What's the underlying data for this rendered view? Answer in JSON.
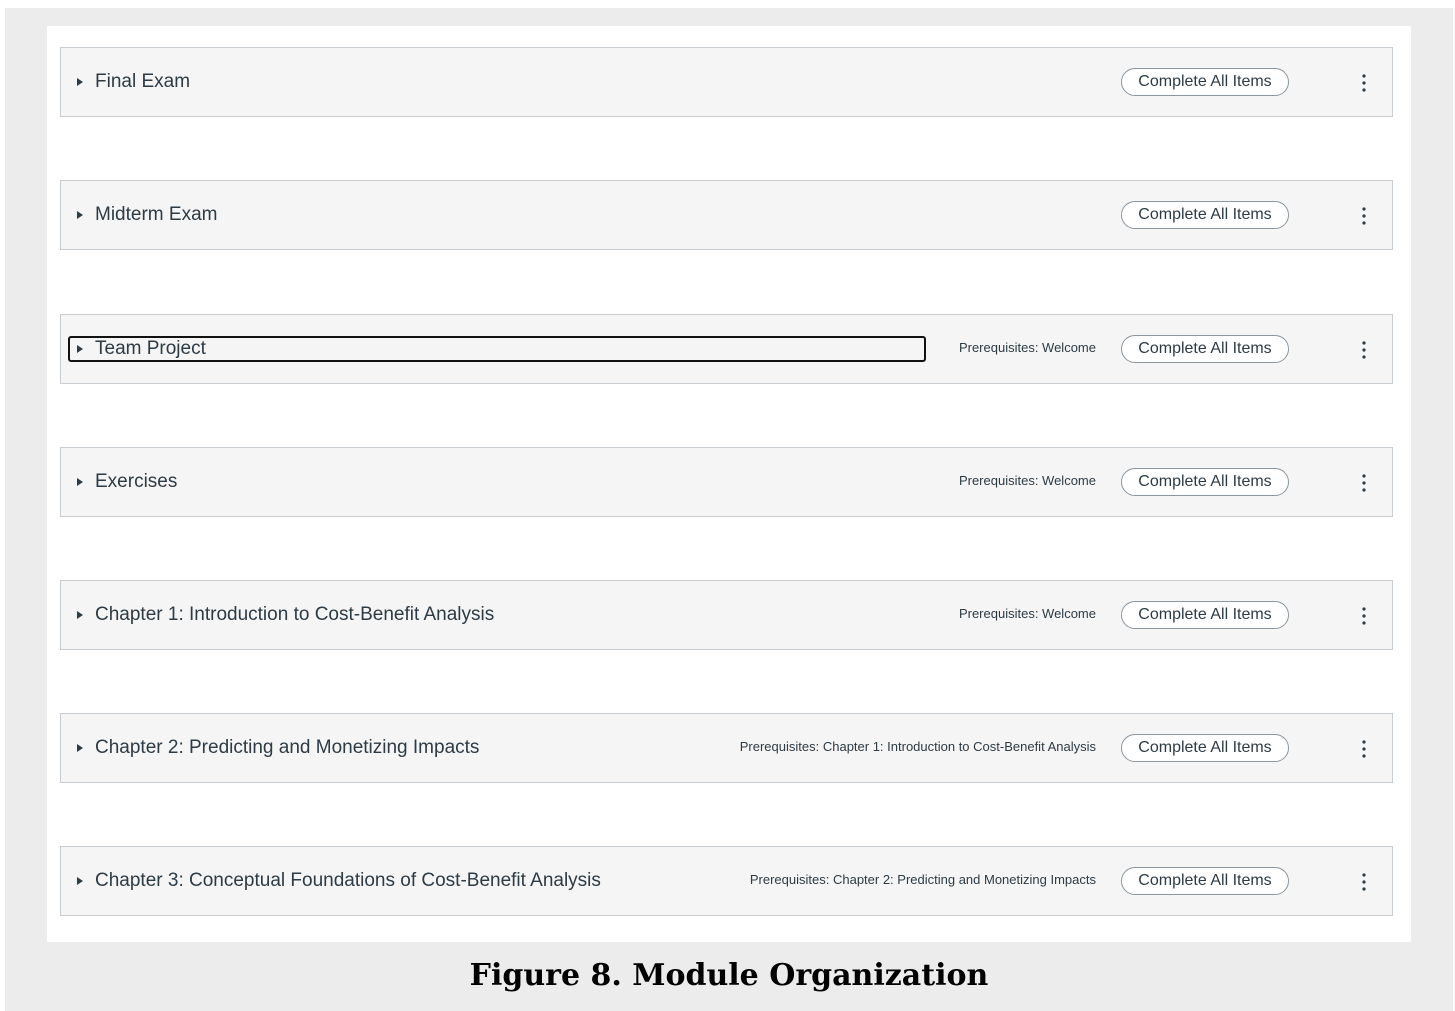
{
  "modules": [
    {
      "title": "Final Exam",
      "prerequisites": "",
      "requirement": "Complete All Items"
    },
    {
      "title": "Midterm Exam",
      "prerequisites": "",
      "requirement": "Complete All Items"
    },
    {
      "title": "Team Project",
      "prerequisites": "Prerequisites: Welcome",
      "requirement": "Complete All Items"
    },
    {
      "title": "Exercises",
      "prerequisites": "Prerequisites: Welcome",
      "requirement": "Complete All Items"
    },
    {
      "title": "Chapter 1: Introduction to Cost-Benefit Analysis",
      "prerequisites": "Prerequisites: Welcome",
      "requirement": "Complete All Items"
    },
    {
      "title": "Chapter 2: Predicting and Monetizing Impacts",
      "prerequisites": "Prerequisites: Chapter 1: Introduction to Cost-Benefit Analysis",
      "requirement": "Complete All Items"
    },
    {
      "title": "Chapter 3: Conceptual Foundations of Cost-Benefit Analysis",
      "prerequisites": "Prerequisites: Chapter 2: Predicting and Monetizing Impacts",
      "requirement": "Complete All Items"
    }
  ],
  "icons": {
    "expand": "caret-right-icon",
    "menu": "kebab-menu-icon"
  },
  "colors": {
    "module_header_bg": "#f5f5f5",
    "border": "#c7cdd1",
    "text": "#2d3b45",
    "page_bg": "#ececec"
  },
  "caption": "Figure 8. Module Organization"
}
